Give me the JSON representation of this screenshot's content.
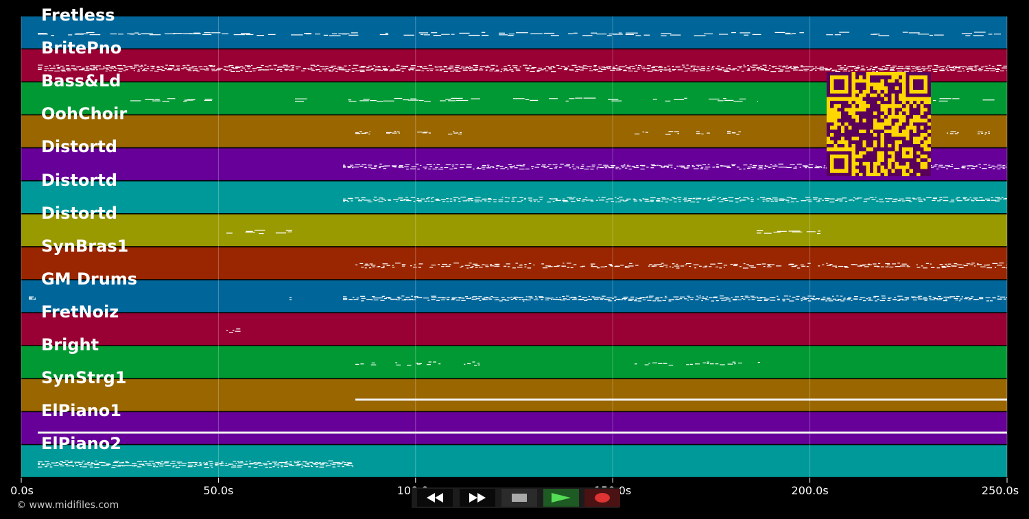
{
  "tracks": [
    {
      "name": "Fretless",
      "color": "#006699"
    },
    {
      "name": "BritePno",
      "color": "#990033"
    },
    {
      "name": "Bass&Ld",
      "color": "#009933"
    },
    {
      "name": "OohChoir",
      "color": "#996600"
    },
    {
      "name": "Distortd",
      "color": "#660099"
    },
    {
      "name": "Distortd",
      "color": "#009999"
    },
    {
      "name": "Distortd",
      "color": "#999900"
    },
    {
      "name": "SynBras1",
      "color": "#992600"
    },
    {
      "name": "GM Drums",
      "color": "#006699"
    },
    {
      "name": "FretNoiz",
      "color": "#990033"
    },
    {
      "name": "Bright",
      "color": "#009933"
    },
    {
      "name": "SynStrg1",
      "color": "#996600"
    },
    {
      "name": "ElPiano1",
      "color": "#660099"
    },
    {
      "name": "ElPiano2",
      "color": "#009999"
    }
  ],
  "timeline": {
    "max_seconds": 252,
    "ticks": [
      {
        "seconds": 0,
        "label": "0.0s"
      },
      {
        "seconds": 50,
        "label": "50.0s"
      },
      {
        "seconds": 100,
        "label": "100.0s"
      },
      {
        "seconds": 150,
        "label": "150.0s"
      },
      {
        "seconds": 200,
        "label": "200.0s"
      },
      {
        "seconds": 250,
        "label": "250.0s"
      }
    ]
  },
  "copyright": "© www.midifiles.com",
  "qr": {
    "foreground": "#5a005a",
    "background": "#ffd700"
  },
  "transport": {
    "buttons": [
      {
        "name": "rewind-button",
        "icon": "rewind-icon"
      },
      {
        "name": "fast-forward-button",
        "icon": "fast-forward-icon"
      },
      {
        "name": "stop-button",
        "icon": "stop-icon"
      },
      {
        "name": "play-button",
        "icon": "play-icon"
      },
      {
        "name": "record-button",
        "icon": "record-icon"
      }
    ]
  }
}
